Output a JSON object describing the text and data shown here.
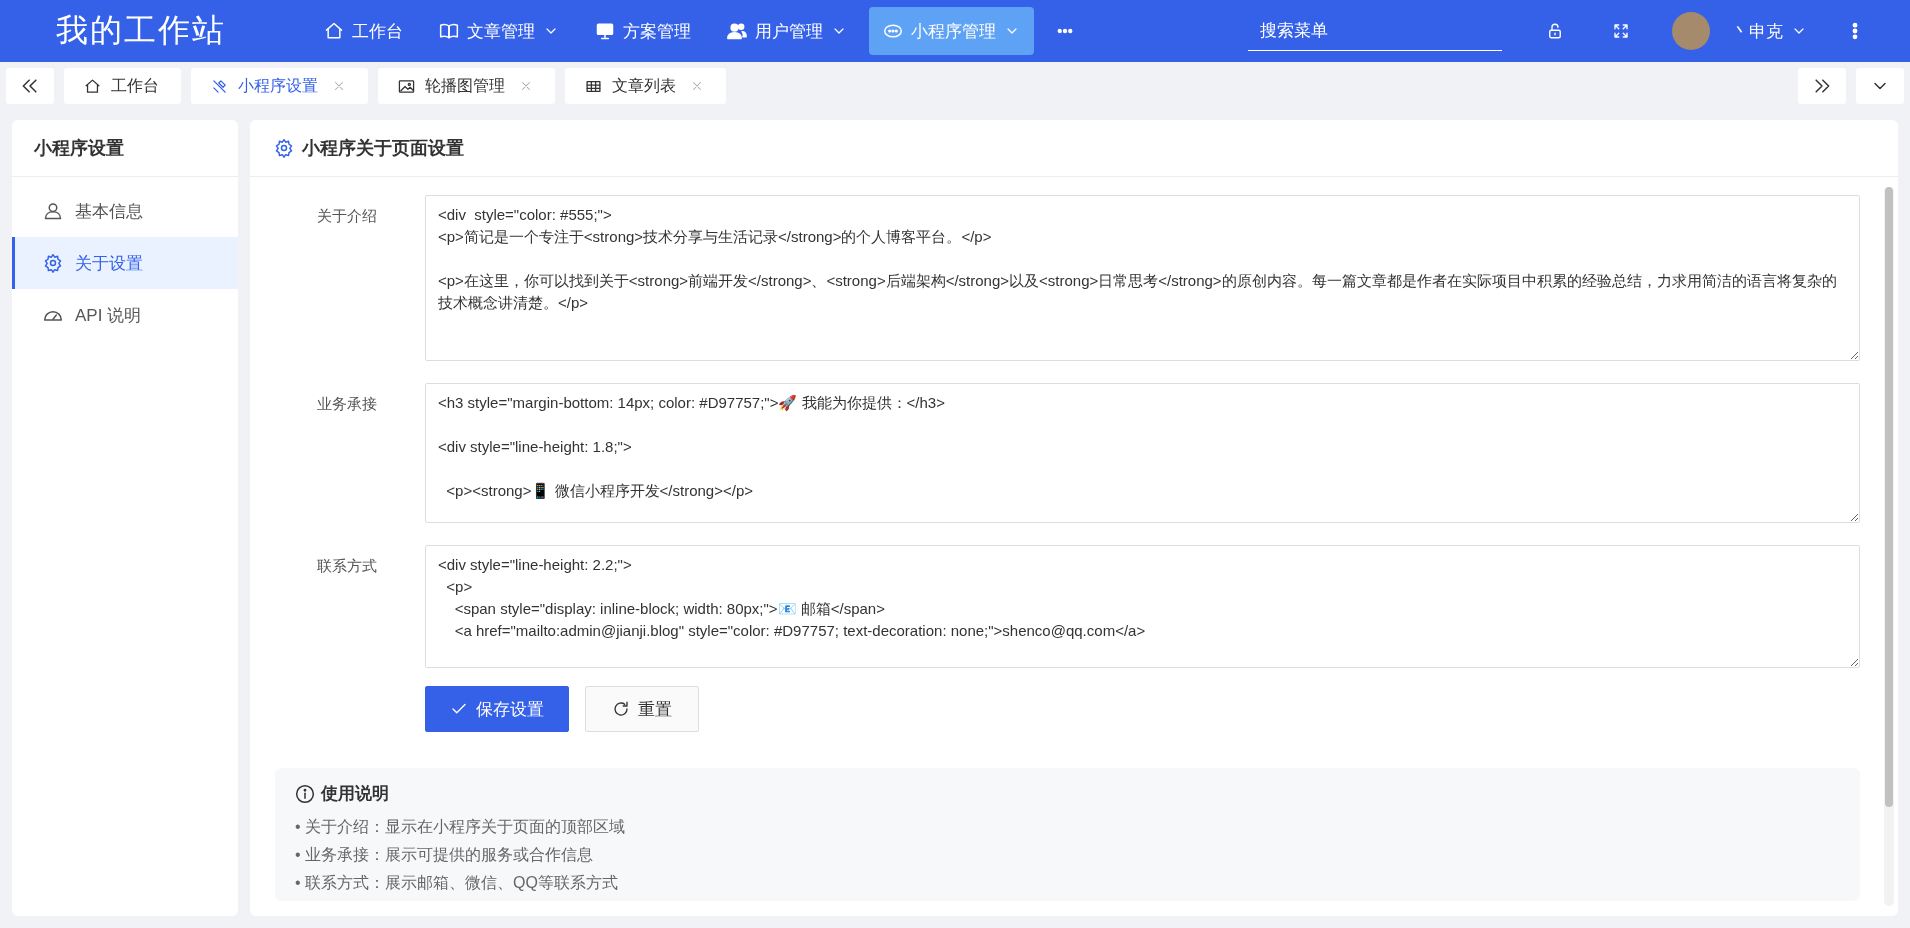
{
  "app": {
    "title": "我的工作站"
  },
  "nav": [
    {
      "label": "工作台",
      "dropdown": false,
      "selected": false
    },
    {
      "label": "文章管理",
      "dropdown": true,
      "selected": false
    },
    {
      "label": "方案管理",
      "dropdown": false,
      "selected": false
    },
    {
      "label": "用户管理",
      "dropdown": true,
      "selected": false
    },
    {
      "label": "小程序管理",
      "dropdown": true,
      "selected": true
    }
  ],
  "search": {
    "placeholder": "搜索菜单"
  },
  "user": {
    "name": "丶申克"
  },
  "tabs": [
    {
      "label": "工作台",
      "closable": false,
      "selected": false
    },
    {
      "label": "小程序设置",
      "closable": true,
      "selected": true
    },
    {
      "label": "轮播图管理",
      "closable": true,
      "selected": false
    },
    {
      "label": "文章列表",
      "closable": true,
      "selected": false
    }
  ],
  "sidebar": {
    "title": "小程序设置",
    "items": [
      {
        "label": "基本信息",
        "selected": false
      },
      {
        "label": "关于设置",
        "selected": true
      },
      {
        "label": "API 说明",
        "selected": false
      }
    ]
  },
  "panel": {
    "title": "小程序关于页面设置",
    "fields": [
      {
        "label": "关于介绍",
        "value": "<div  style=\"color: #555;\">\n<p>简记是一个专注于<strong>技术分享与生活记录</strong>的个人博客平台。</p>\n\n<p>在这里，你可以找到关于<strong>前端开发</strong>、<strong>后端架构</strong>以及<strong>日常思考</strong>的原创内容。每一篇文章都是作者在实际项目中积累的经验总结，力求用简洁的语言将复杂的技术概念讲清楚。</p>"
      },
      {
        "label": "业务承接",
        "value": "<h3 style=\"margin-bottom: 14px; color: #D97757;\">🚀 我能为你提供：</h3>\n\n<div style=\"line-height: 1.8;\">\n\n  <p><strong>📱 微信小程序开发</strong></p>"
      },
      {
        "label": "联系方式",
        "value": "<div style=\"line-height: 2.2;\">\n  <p>\n    <span style=\"display: inline-block; width: 80px;\">📧 邮箱</span>\n    <a href=\"mailto:admin@jianji.blog\" style=\"color: #D97757; text-decoration: none;\">shenco@qq.com</a>"
      }
    ],
    "buttons": [
      {
        "label": "保存设置",
        "kind": "primary"
      },
      {
        "label": "重置",
        "kind": "default"
      }
    ],
    "help": {
      "title": "使用说明",
      "items": [
        "• 关于介绍：显示在小程序关于页面的顶部区域",
        "• 业务承接：展示可提供的服务或合作信息",
        "• 联系方式：展示邮箱、微信、QQ等联系方式"
      ]
    }
  }
}
